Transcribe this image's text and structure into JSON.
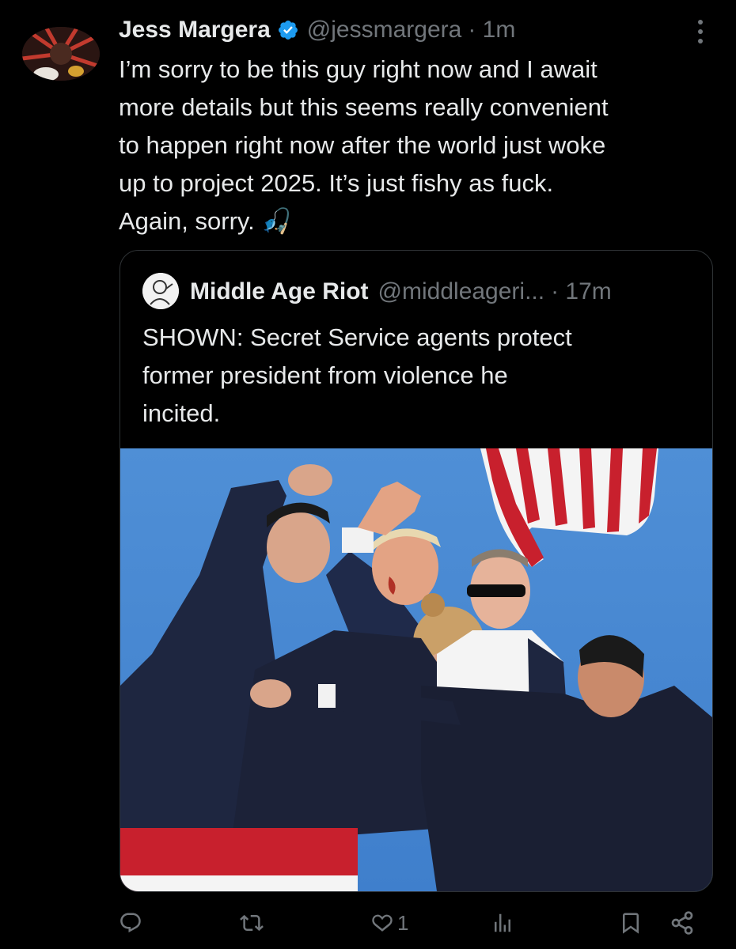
{
  "author": {
    "name": "Jess Margera",
    "handle": "@jessmargera",
    "time": "· 1m",
    "verified": true
  },
  "tweet": {
    "text_lines": [
      "I’m sorry to be this guy right now and I await",
      "more details but this seems really convenient",
      "to happen right now after the world just woke",
      "up to project 2025. It’s just fishy as fuck.",
      "Again, sorry. 🎣"
    ]
  },
  "quote": {
    "name": "Middle Age Riot",
    "handle": "@middleageri...",
    "time": "· 17m",
    "text_lines": [
      "SHOWN: Secret Service agents protect",
      "former president from violence he",
      "incited."
    ],
    "photo_icon": "photo-image"
  },
  "actions": {
    "reply_icon": "reply-icon",
    "retweet_icon": "retweet-icon",
    "like_icon": "heart-icon",
    "like_count": "1",
    "views_icon": "views-icon",
    "bookmark_icon": "bookmark-icon",
    "share_icon": "share-icon"
  },
  "colors": {
    "background": "#000000",
    "text": "#e7e9ea",
    "secondary": "#71767b",
    "verified": "#1d9bf0",
    "border": "#2f3336"
  }
}
